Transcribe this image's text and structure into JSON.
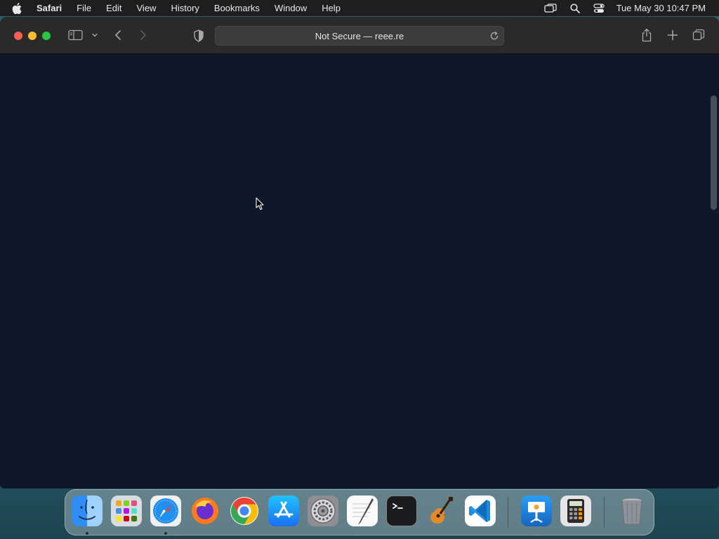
{
  "menubar": {
    "app_name": "Safari",
    "items": [
      "File",
      "Edit",
      "View",
      "History",
      "Bookmarks",
      "Window",
      "Help"
    ],
    "clock": "Tue May 30  10:47 PM",
    "status_icons": [
      "screen-mirroring-icon",
      "spotlight-search-icon",
      "control-center-icon"
    ]
  },
  "browser": {
    "address_text": "Not Secure — reee.re",
    "page_background": "#0f172a"
  },
  "dock": {
    "apps": [
      "Finder",
      "Launchpad",
      "Safari",
      "Firefox",
      "Google Chrome",
      "App Store",
      "System Settings",
      "TextEdit",
      "Terminal",
      "GarageBand",
      "Visual Studio Code",
      "Keynote",
      "Calculator",
      "Trash"
    ],
    "running": [
      "Finder",
      "Safari"
    ]
  }
}
